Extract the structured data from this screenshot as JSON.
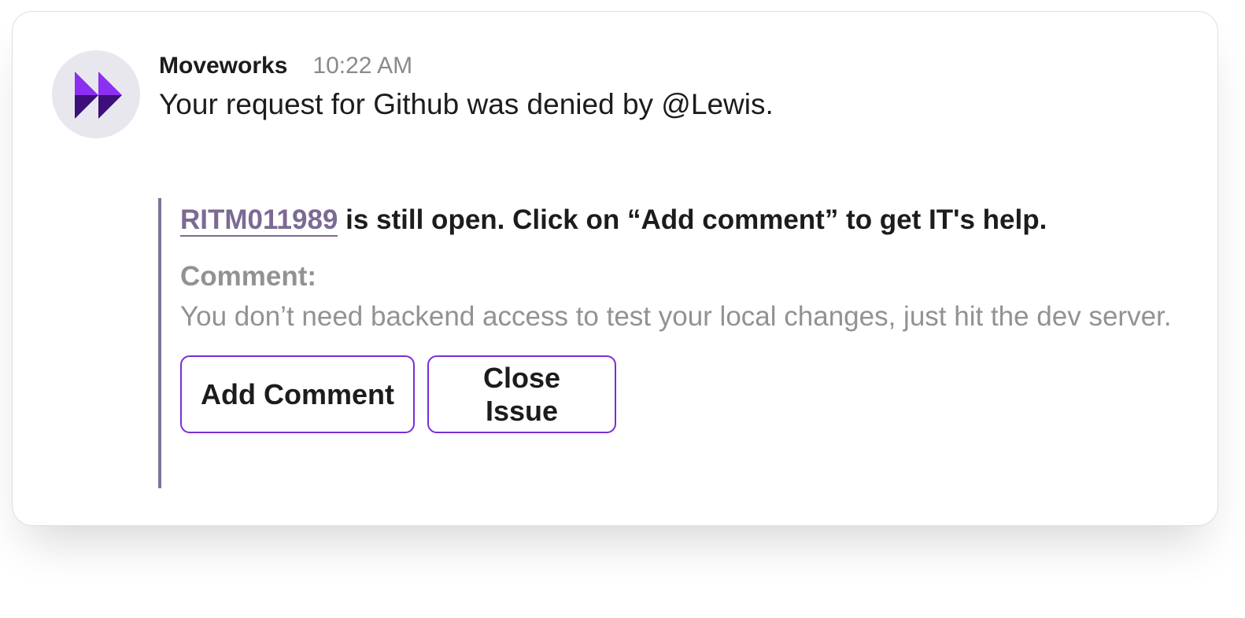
{
  "message": {
    "sender": "Moveworks",
    "time": "10:22 AM",
    "text": "Your request for Github was denied by @Lewis."
  },
  "attachment": {
    "ticket_id": "RITM011989",
    "title_rest": " is still open. Click on “Add comment” to get IT's help.",
    "comment_label": "Comment:",
    "comment_text": "You don’t need backend access to test your local changes, just hit the dev server."
  },
  "buttons": {
    "add_comment": "Add Comment",
    "close_issue": "Close Issue"
  },
  "colors": {
    "accent": "#7a2dd8",
    "link": "#7b6a94",
    "attachment_bar": "#7e7399",
    "logo_light": "#8b2ff0",
    "logo_dark": "#3c0f7a"
  },
  "icons": {
    "avatar": "moveworks-logo-icon"
  }
}
